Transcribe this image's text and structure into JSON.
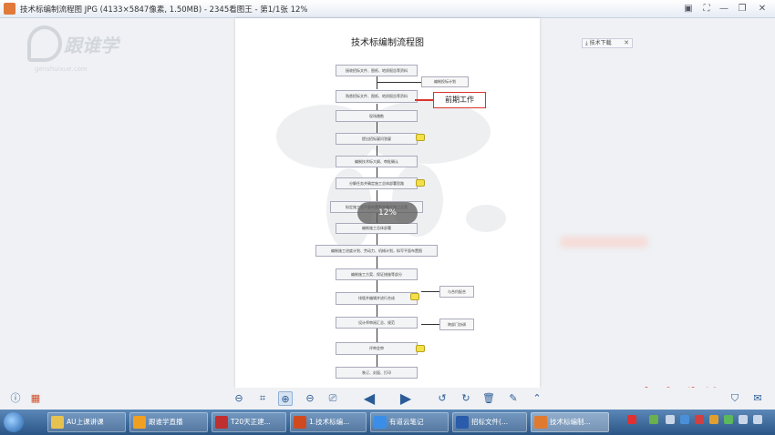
{
  "window": {
    "title": "技术标编制流程图 JPG (4133×5847像素, 1.50MB) - 2345看图王 - 第1/1张 12%"
  },
  "logo": {
    "text": "跟谁学",
    "sub": "genshuixue.com"
  },
  "download": {
    "label": "技术下载",
    "close": "✕"
  },
  "document": {
    "title": "技术标编制流程图",
    "callout": "前期工作",
    "zoom_badge": "12%",
    "steps": [
      "接收招标文件、图纸、地质报告等资料",
      "熟悉招标文件、图纸、地质报告等资料",
      "现场踏勘",
      "提出招标疑问答疑",
      "编制技术标大纲、审批确认",
      "分解任务并确定施工总体部署思路",
      "拟定施工总平面布置图并确定施工方案",
      "编制施工总体部署",
      "编制施工进度计划、劳动力、机械计划，拟写平面布置图",
      "编制施工方案、保证措施等部分",
      "排版并编辑并进行合成",
      "设计师审阅汇总、规范",
      "评审会审",
      "装订、封面、打印"
    ],
    "side_boxes": [
      "编制投标计划",
      "与合约配合",
      "跨部门协调"
    ]
  },
  "watermark": "未来造价",
  "taskbar": {
    "items": [
      {
        "label": "AU上课讲课",
        "color": "#e8c250"
      },
      {
        "label": "跟谁学直播",
        "color": "#f0a020"
      },
      {
        "label": "T20天正建...",
        "color": "#c03030"
      },
      {
        "label": "1.技术标编...",
        "color": "#d04a20"
      },
      {
        "label": "有道云笔记",
        "color": "#3b8ee8"
      },
      {
        "label": "招标文件(...",
        "color": "#2b5cab"
      },
      {
        "label": "技术标编制...",
        "color": "#e07a30"
      }
    ]
  },
  "colors": {
    "accent": "#d9342b",
    "watermark": "#e0201b",
    "toolbar_icon": "#2b5c96"
  }
}
